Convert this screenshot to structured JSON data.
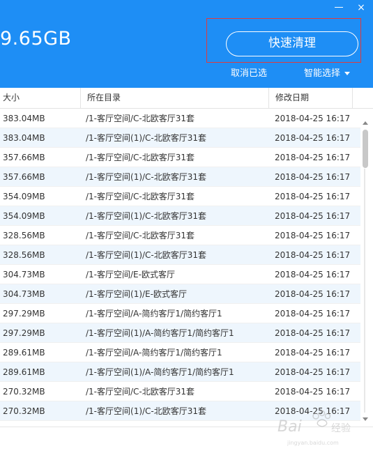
{
  "header": {
    "total_size": "9.65GB",
    "clean_button_label": "快速清理",
    "cancel_selection_label": "取消已选",
    "smart_select_label": "智能选择"
  },
  "window_controls": {
    "minimize_icon": "minimize-icon",
    "close_icon": "close-icon",
    "close_glyph": "×"
  },
  "table": {
    "columns": [
      "大小",
      "所在目录",
      "修改日期"
    ],
    "rows": [
      {
        "size": "383.04MB",
        "dir": "/1-客厅空间/C-北欧客厅31套",
        "date": "2018-04-25 16:17"
      },
      {
        "size": "383.04MB",
        "dir": "/1-客厅空间(1)/C-北欧客厅31套",
        "date": "2018-04-25 16:17"
      },
      {
        "size": "357.66MB",
        "dir": "/1-客厅空间/C-北欧客厅31套",
        "date": "2018-04-25 16:17"
      },
      {
        "size": "357.66MB",
        "dir": "/1-客厅空间(1)/C-北欧客厅31套",
        "date": "2018-04-25 16:17"
      },
      {
        "size": "354.09MB",
        "dir": "/1-客厅空间/C-北欧客厅31套",
        "date": "2018-04-25 16:17"
      },
      {
        "size": "354.09MB",
        "dir": "/1-客厅空间(1)/C-北欧客厅31套",
        "date": "2018-04-25 16:17"
      },
      {
        "size": "328.56MB",
        "dir": "/1-客厅空间/C-北欧客厅31套",
        "date": "2018-04-25 16:17"
      },
      {
        "size": "328.56MB",
        "dir": "/1-客厅空间(1)/C-北欧客厅31套",
        "date": "2018-04-25 16:17"
      },
      {
        "size": "304.73MB",
        "dir": "/1-客厅空间/E-欧式客厅",
        "date": "2018-04-25 16:17"
      },
      {
        "size": "304.73MB",
        "dir": "/1-客厅空间(1)/E-欧式客厅",
        "date": "2018-04-25 16:17"
      },
      {
        "size": "297.29MB",
        "dir": "/1-客厅空间/A-简约客厅1/简约客厅1",
        "date": "2018-04-25 16:17"
      },
      {
        "size": "297.29MB",
        "dir": "/1-客厅空间(1)/A-简约客厅1/简约客厅1",
        "date": "2018-04-25 16:17"
      },
      {
        "size": "289.61MB",
        "dir": "/1-客厅空间/A-简约客厅1/简约客厅1",
        "date": "2018-04-25 16:17"
      },
      {
        "size": "289.61MB",
        "dir": "/1-客厅空间(1)/A-简约客厅1/简约客厅1",
        "date": "2018-04-25 16:17"
      },
      {
        "size": "270.32MB",
        "dir": "/1-客厅空间/C-北欧客厅31套",
        "date": "2018-04-25 16:17"
      },
      {
        "size": "270.32MB",
        "dir": "/1-客厅空间(1)/C-北欧客厅31套",
        "date": "2018-04-25 16:17"
      }
    ]
  },
  "scrollbar": {
    "position_fraction": 0.0
  },
  "colors": {
    "header_bg": "#1e8ef5",
    "row_alt_bg": "#eef6fd",
    "highlight_border": "#e23a3a"
  },
  "watermark": {
    "brand": "Baidu经验",
    "url": "jingyan.baidu.com"
  }
}
